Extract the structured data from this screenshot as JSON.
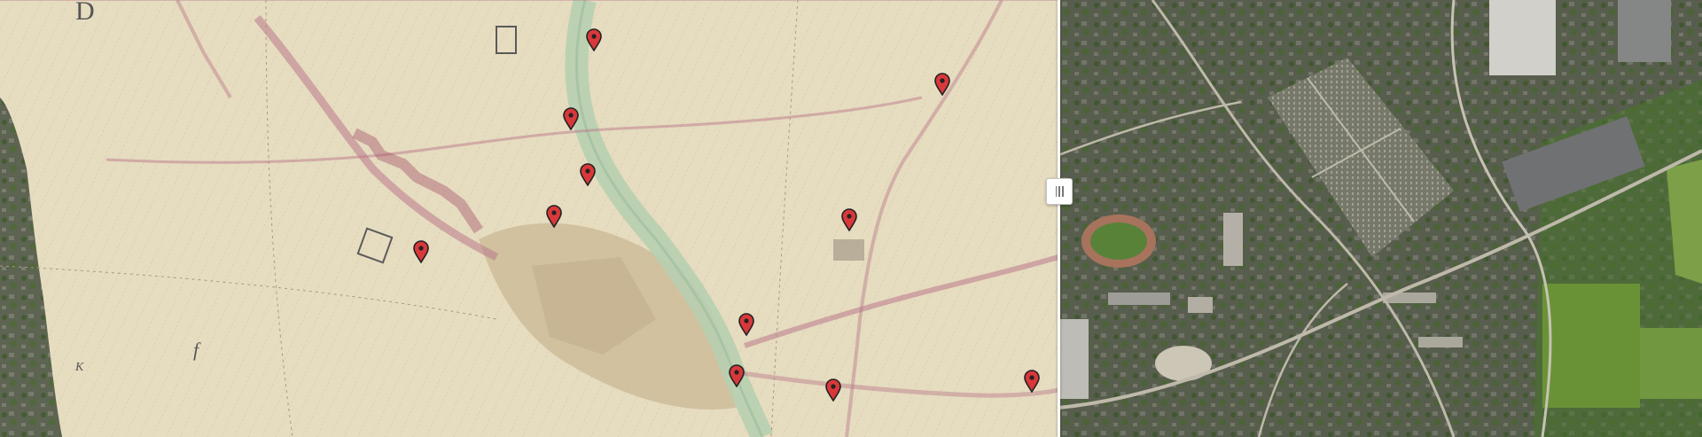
{
  "map": {
    "left_layer": "historical-cadastral-map",
    "right_layer": "satellite-imagery",
    "map_labels": {
      "label_d": "D",
      "label_k": "K",
      "label_f": "f"
    }
  },
  "markers": [
    {
      "name": "marker-1"
    },
    {
      "name": "marker-2"
    },
    {
      "name": "marker-3"
    },
    {
      "name": "marker-4"
    },
    {
      "name": "marker-5"
    },
    {
      "name": "marker-6"
    },
    {
      "name": "marker-7"
    },
    {
      "name": "marker-8"
    },
    {
      "name": "marker-9"
    },
    {
      "name": "marker-10"
    },
    {
      "name": "marker-11"
    }
  ],
  "colors": {
    "parchment": "#e6dcc0",
    "river": "#b7cfb0",
    "built_area": "#b9788a",
    "marker_red": "#d9383a",
    "marker_outline": "#222222",
    "satellite_base": "#5d6452",
    "divider": "#ffffff"
  },
  "controls": {
    "swipe_handle": "grip-icon"
  }
}
